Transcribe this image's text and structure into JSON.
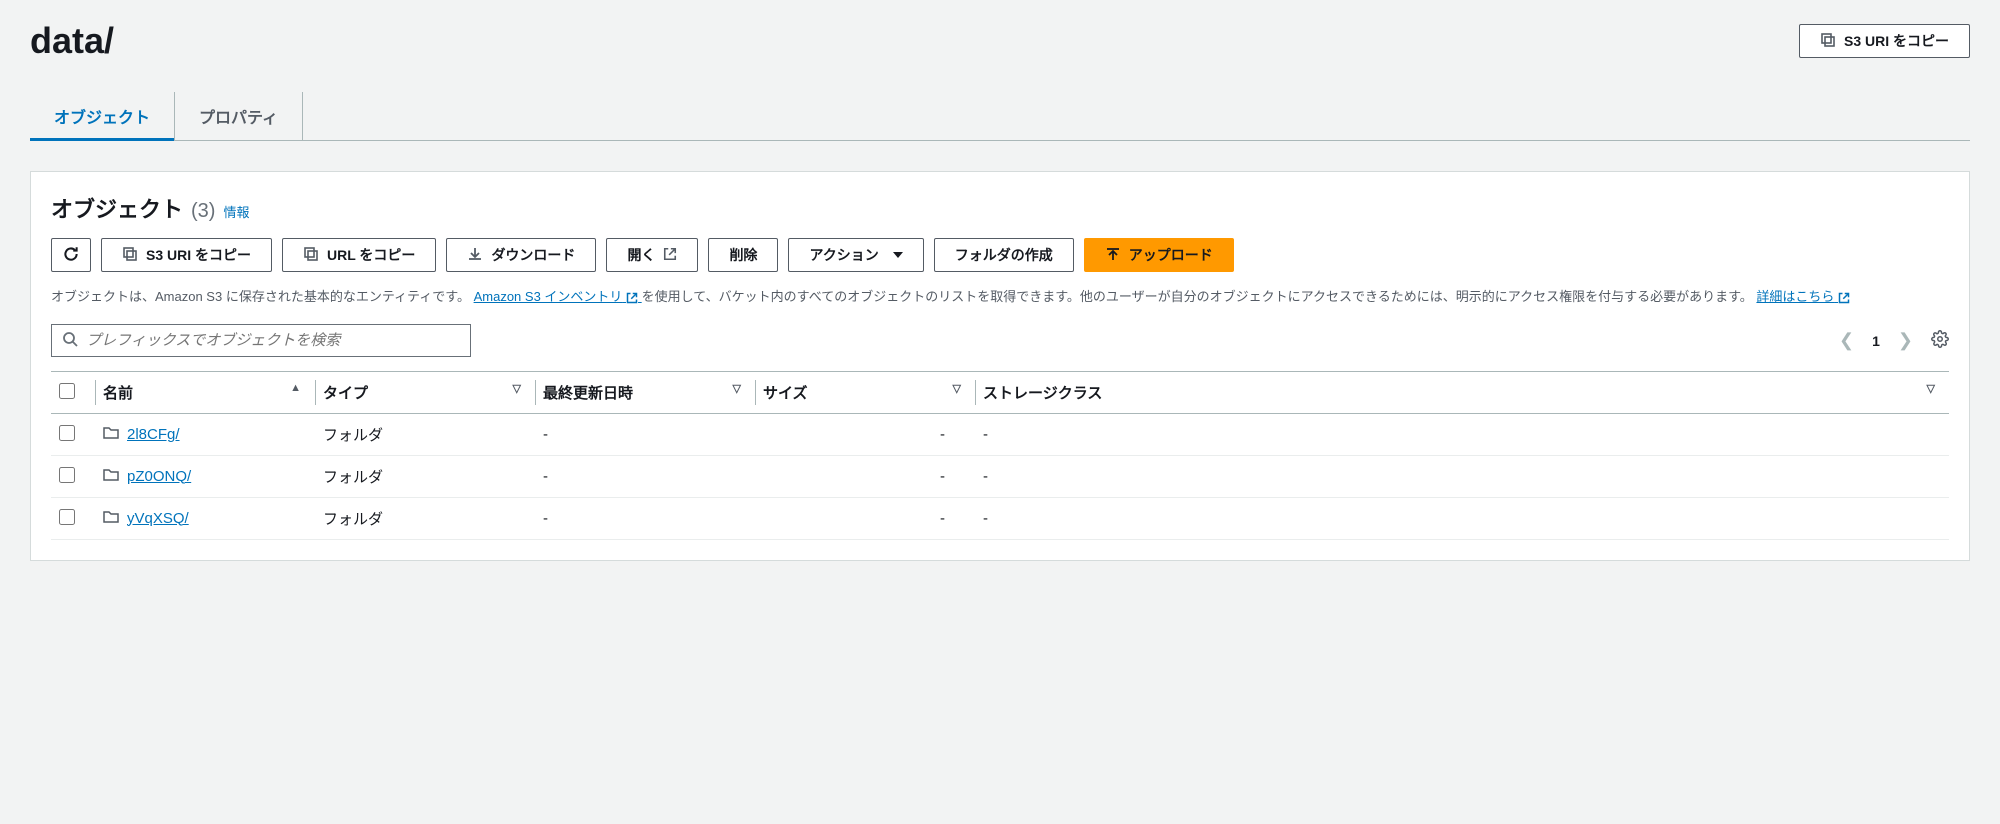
{
  "header": {
    "title": "data/",
    "copy_uri_label": "S3 URI をコピー"
  },
  "tabs": [
    {
      "label": "オブジェクト",
      "active": true
    },
    {
      "label": "プロパティ",
      "active": false
    }
  ],
  "panel": {
    "title": "オブジェクト",
    "count": "(3)",
    "info": "情報"
  },
  "toolbar": {
    "copy_s3_uri": "S3 URI をコピー",
    "copy_url": "URL をコピー",
    "download": "ダウンロード",
    "open": "開く",
    "delete": "削除",
    "actions": "アクション",
    "create_folder": "フォルダの作成",
    "upload": "アップロード"
  },
  "description": {
    "part1": "オブジェクトは、Amazon S3 に保存された基本的なエンティティです。",
    "link1": "Amazon S3 インベントリ",
    "part2": "を使用して、バケット内のすべてのオブジェクトのリストを取得できます。他のユーザーが自分のオブジェクトにアクセスできるためには、明示的にアクセス権限を付与する必要があります。",
    "link2": "詳細はこちら"
  },
  "search": {
    "placeholder": "プレフィックスでオブジェクトを検索"
  },
  "pagination": {
    "current": "1"
  },
  "table": {
    "columns": {
      "name": "名前",
      "type": "タイプ",
      "last_modified": "最終更新日時",
      "size": "サイズ",
      "storage_class": "ストレージクラス"
    },
    "rows": [
      {
        "name": "2l8CFg/",
        "type": "フォルダ",
        "last_modified": "-",
        "size": "-",
        "storage_class": "-"
      },
      {
        "name": "pZ0ONQ/",
        "type": "フォルダ",
        "last_modified": "-",
        "size": "-",
        "storage_class": "-"
      },
      {
        "name": "yVqXSQ/",
        "type": "フォルダ",
        "last_modified": "-",
        "size": "-",
        "storage_class": "-"
      }
    ]
  }
}
